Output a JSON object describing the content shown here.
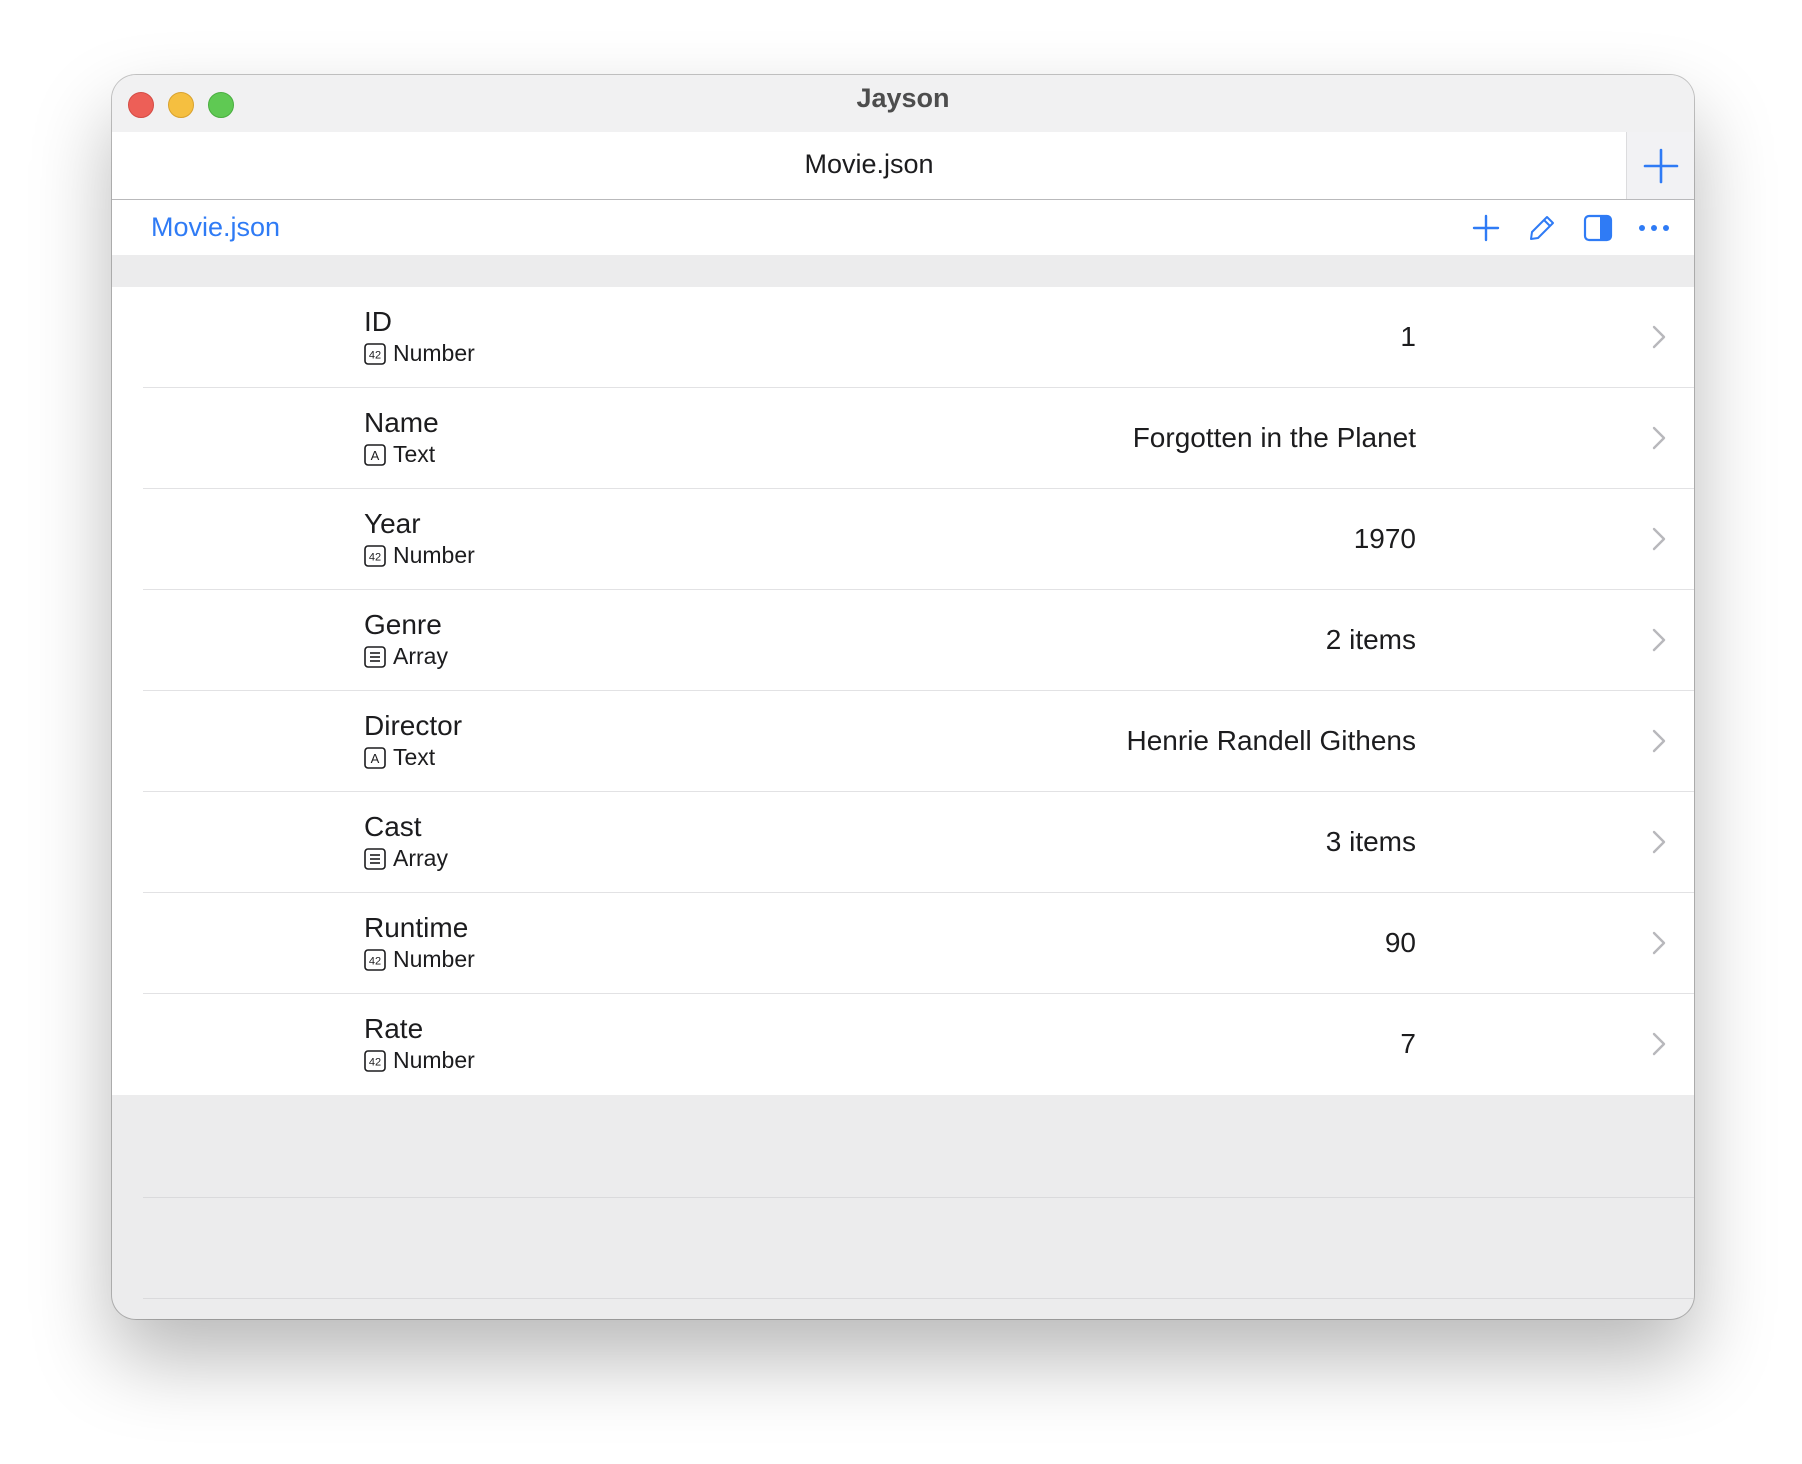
{
  "window": {
    "title": "Jayson"
  },
  "tabbar": {
    "title": "Movie.json"
  },
  "navbar": {
    "breadcrumb": "Movie.json"
  },
  "colors": {
    "accent": "#2f7bf5",
    "close": "#ed5f57",
    "minimize": "#f5bf40",
    "maximize": "#5fc953"
  },
  "rows": [
    {
      "key": "ID",
      "type": "Number",
      "type_icon": "number-icon",
      "value": "1"
    },
    {
      "key": "Name",
      "type": "Text",
      "type_icon": "text-icon",
      "value": "Forgotten in the Planet"
    },
    {
      "key": "Year",
      "type": "Number",
      "type_icon": "number-icon",
      "value": "1970"
    },
    {
      "key": "Genre",
      "type": "Array",
      "type_icon": "array-icon",
      "value": "2 items"
    },
    {
      "key": "Director",
      "type": "Text",
      "type_icon": "text-icon",
      "value": "Henrie Randell Githens"
    },
    {
      "key": "Cast",
      "type": "Array",
      "type_icon": "array-icon",
      "value": "3 items"
    },
    {
      "key": "Runtime",
      "type": "Number",
      "type_icon": "number-icon",
      "value": "90"
    },
    {
      "key": "Rate",
      "type": "Number",
      "type_icon": "number-icon",
      "value": "7"
    }
  ]
}
